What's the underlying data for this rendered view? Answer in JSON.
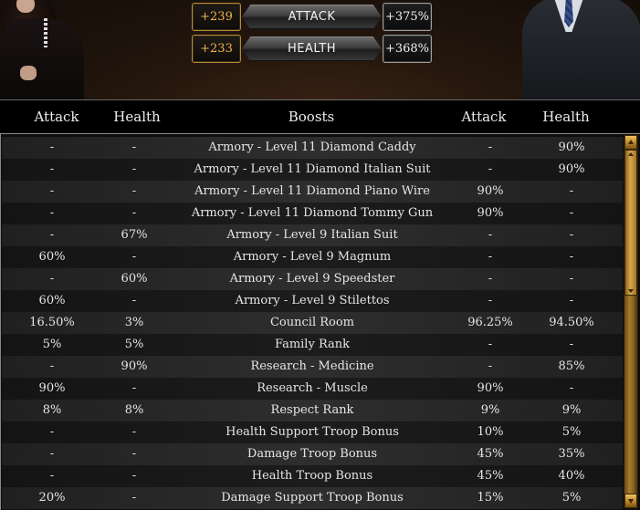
{
  "stats": {
    "attack": {
      "left_bonus": "+239",
      "label": "ATTACK",
      "right_bonus": "+375%"
    },
    "health": {
      "left_bonus": "+233",
      "label": "HEALTH",
      "right_bonus": "+368%"
    }
  },
  "columns": {
    "left_attack": "Attack",
    "left_health": "Health",
    "boosts": "Boosts",
    "right_attack": "Attack",
    "right_health": "Health"
  },
  "rows": [
    {
      "left_attack": "-",
      "left_health": "-",
      "boost": "Armory - Level 11 Diamond Caddy",
      "right_attack": "-",
      "right_health": "90%"
    },
    {
      "left_attack": "-",
      "left_health": "-",
      "boost": "Armory - Level 11 Diamond Italian Suit",
      "right_attack": "-",
      "right_health": "90%"
    },
    {
      "left_attack": "-",
      "left_health": "-",
      "boost": "Armory - Level 11 Diamond Piano Wire",
      "right_attack": "90%",
      "right_health": "-"
    },
    {
      "left_attack": "-",
      "left_health": "-",
      "boost": "Armory - Level 11 Diamond Tommy Gun",
      "right_attack": "90%",
      "right_health": "-"
    },
    {
      "left_attack": "-",
      "left_health": "67%",
      "boost": "Armory - Level 9 Italian Suit",
      "right_attack": "-",
      "right_health": "-"
    },
    {
      "left_attack": "60%",
      "left_health": "-",
      "boost": "Armory - Level 9 Magnum",
      "right_attack": "-",
      "right_health": "-"
    },
    {
      "left_attack": "-",
      "left_health": "60%",
      "boost": "Armory - Level 9 Speedster",
      "right_attack": "-",
      "right_health": "-"
    },
    {
      "left_attack": "60%",
      "left_health": "-",
      "boost": "Armory - Level 9 Stilettos",
      "right_attack": "-",
      "right_health": "-"
    },
    {
      "left_attack": "16.50%",
      "left_health": "3%",
      "boost": "Council Room",
      "right_attack": "96.25%",
      "right_health": "94.50%"
    },
    {
      "left_attack": "5%",
      "left_health": "5%",
      "boost": "Family Rank",
      "right_attack": "-",
      "right_health": "-"
    },
    {
      "left_attack": "-",
      "left_health": "90%",
      "boost": "Research - Medicine",
      "right_attack": "-",
      "right_health": "85%"
    },
    {
      "left_attack": "90%",
      "left_health": "-",
      "boost": "Research - Muscle",
      "right_attack": "90%",
      "right_health": "-"
    },
    {
      "left_attack": "8%",
      "left_health": "8%",
      "boost": "Respect Rank",
      "right_attack": "9%",
      "right_health": "9%"
    },
    {
      "left_attack": "-",
      "left_health": "-",
      "boost": "Health Support Troop Bonus",
      "right_attack": "10%",
      "right_health": "5%"
    },
    {
      "left_attack": "-",
      "left_health": "-",
      "boost": "Damage Troop Bonus",
      "right_attack": "45%",
      "right_health": "35%"
    },
    {
      "left_attack": "-",
      "left_health": "-",
      "boost": "Health Troop Bonus",
      "right_attack": "45%",
      "right_health": "40%"
    },
    {
      "left_attack": "20%",
      "left_health": "-",
      "boost": "Damage Support Troop Bonus",
      "right_attack": "15%",
      "right_health": "5%"
    }
  ],
  "colors": {
    "gold_accent": "#f0b44a",
    "scrollbar_gold": "#b9862c",
    "row_light": "#2e2e2e",
    "row_dark": "#1c1c1c"
  }
}
